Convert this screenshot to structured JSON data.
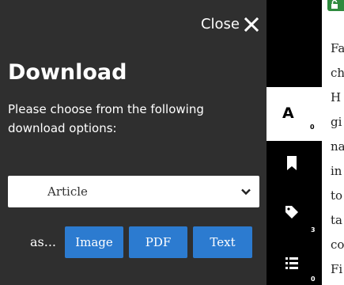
{
  "panel": {
    "close_label": "Close",
    "title": "Download",
    "instructions": "Please choose from the following download options:",
    "format_select": {
      "selected": "Article"
    },
    "as_label": "as...",
    "buttons": {
      "image": "Image",
      "pdf": "PDF",
      "text": "Text"
    },
    "button_color": "#2c7bd0",
    "background": "#2f2f2f"
  },
  "toolbar": {
    "contents_tab": {
      "glyph": "A",
      "count": "0"
    },
    "bookmark": {
      "icon": "bookmark-icon"
    },
    "tags": {
      "icon": "tag-icon",
      "count": "3"
    },
    "list": {
      "icon": "list-icon",
      "count": "0"
    }
  },
  "article": {
    "lines": [
      "Fa",
      "ch",
      "H",
      "gi",
      "na",
      "in",
      "to",
      "ta",
      "co",
      "Fi"
    ],
    "badge_color": "#2e8b3e"
  }
}
